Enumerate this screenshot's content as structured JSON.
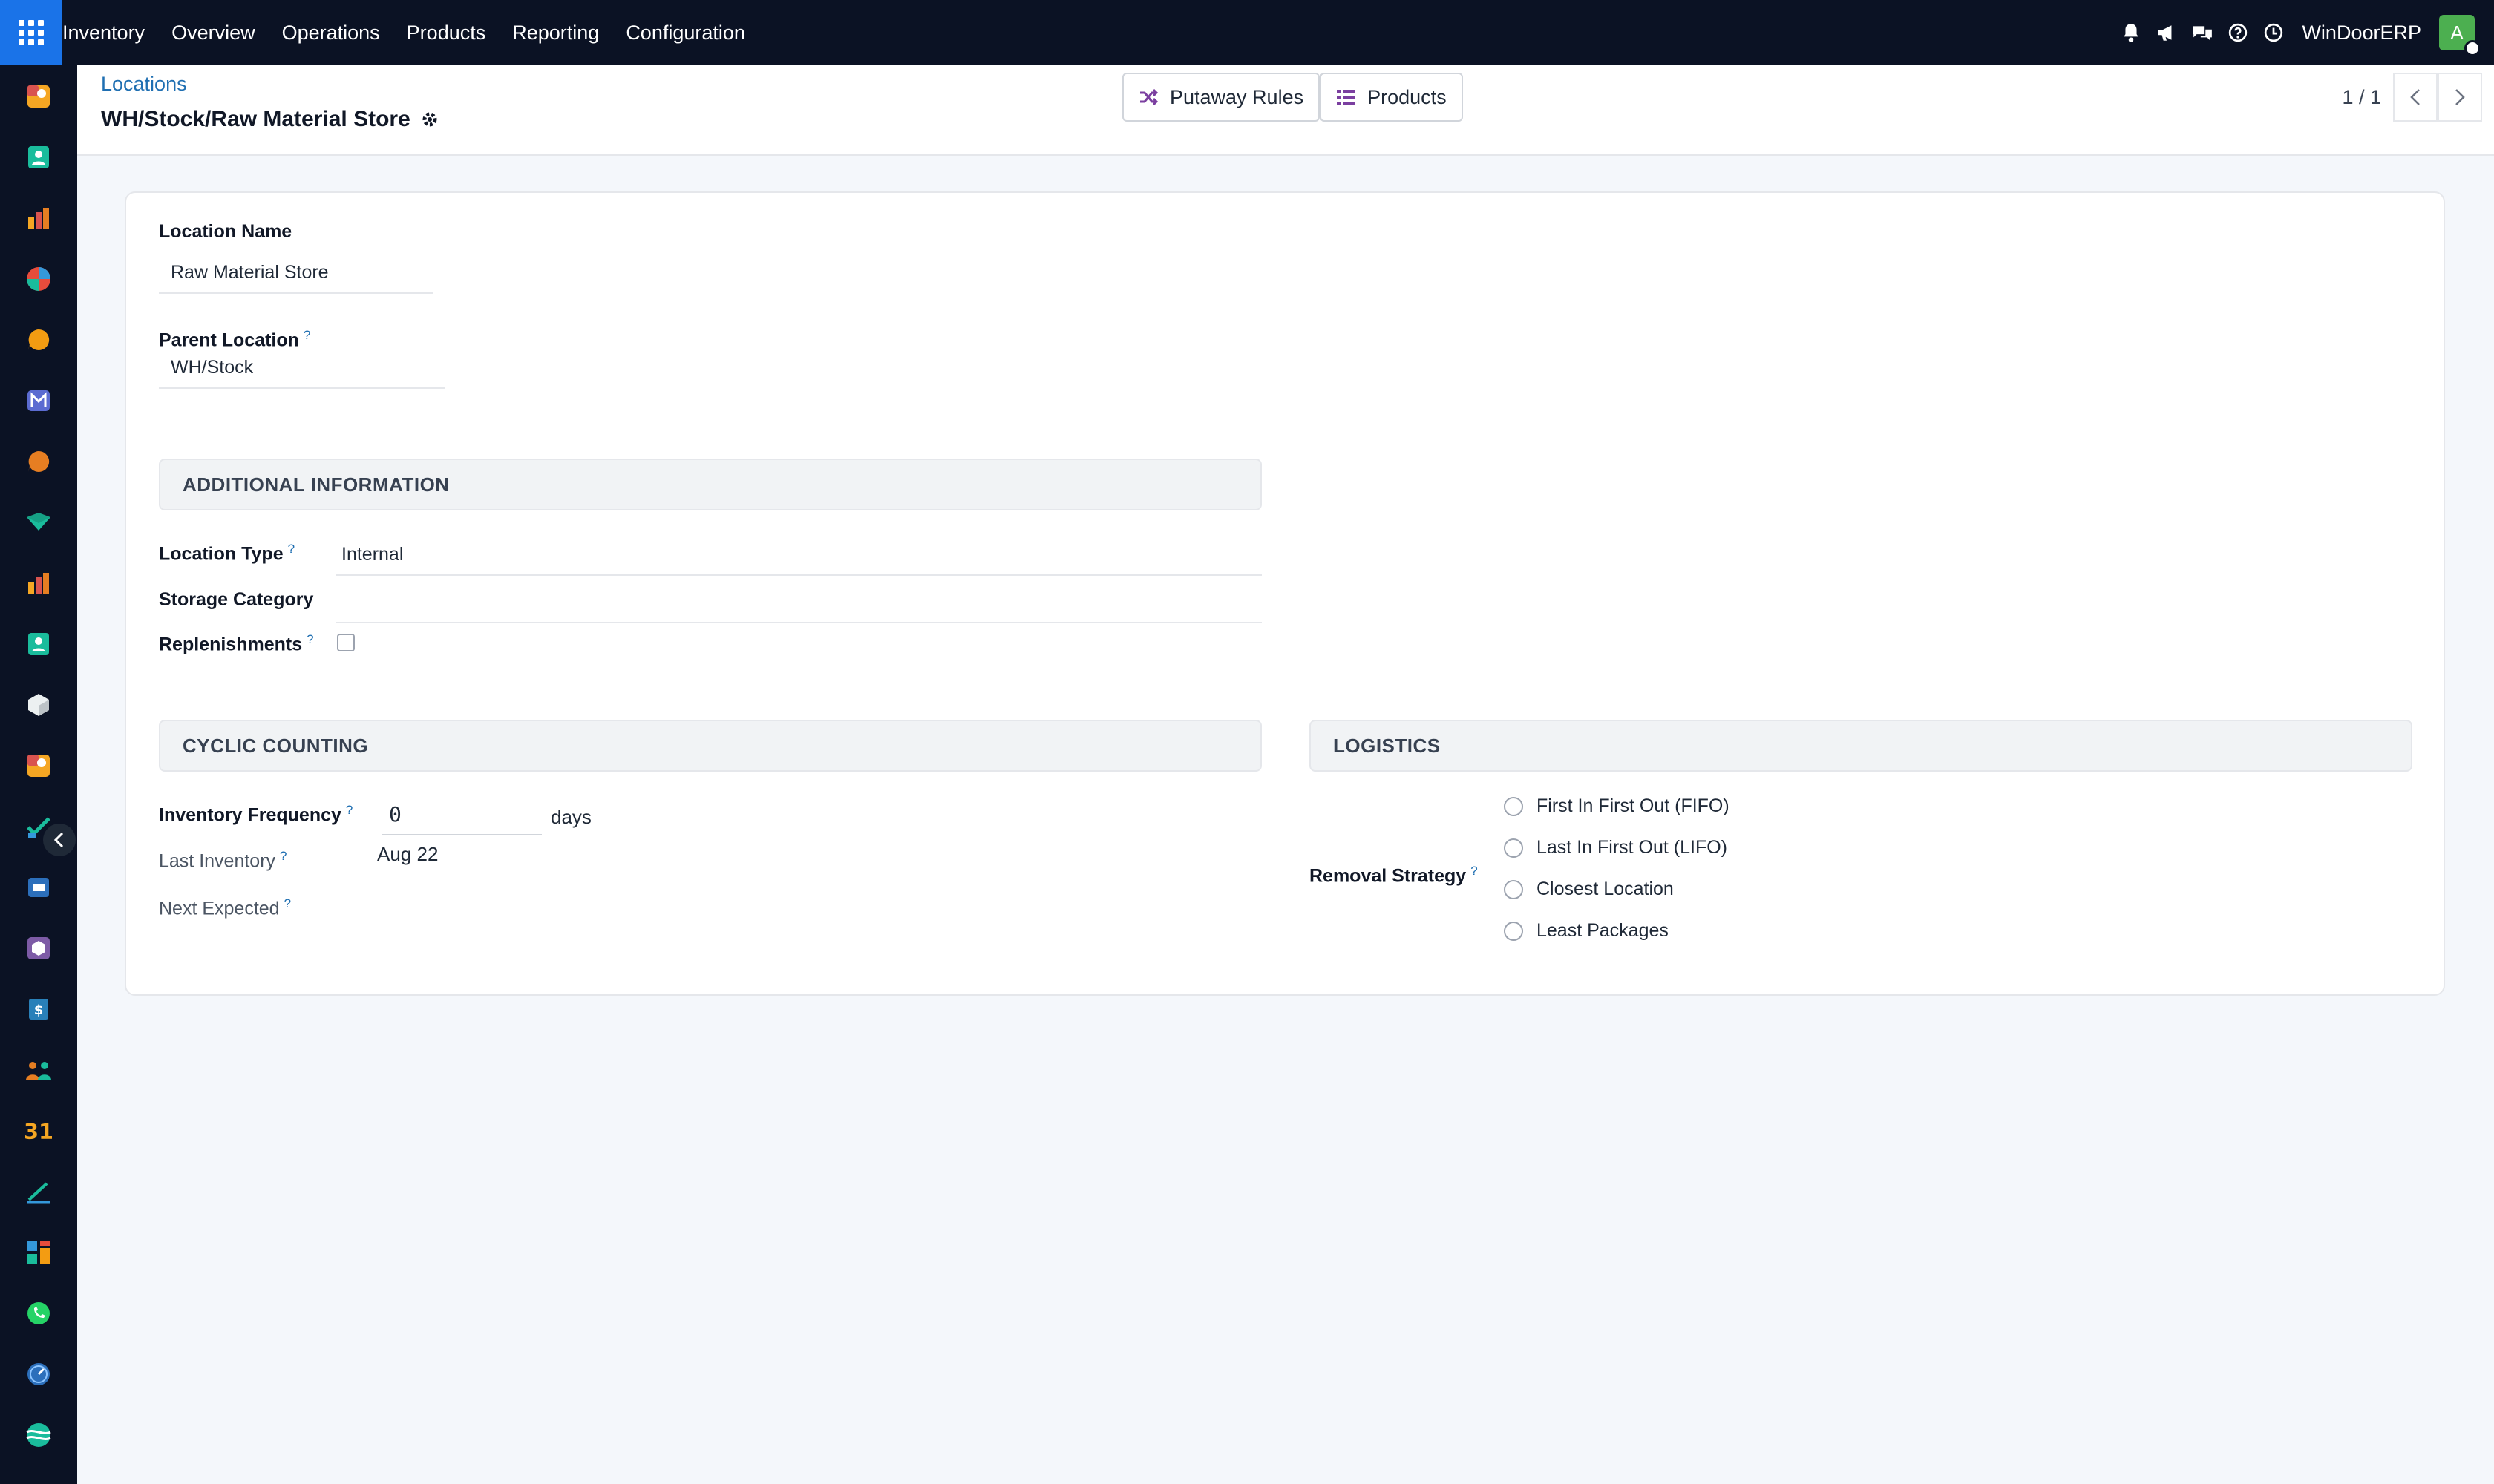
{
  "topbar": {
    "menu": [
      "Inventory",
      "Overview",
      "Operations",
      "Products",
      "Reporting",
      "Configuration"
    ],
    "company": "WinDoorERP",
    "avatar_initial": "A"
  },
  "sidebar": {
    "apps": [
      "studio",
      "contacts",
      "dashboards",
      "discuss",
      "live-chat",
      "mail",
      "helpdesk",
      "marketing",
      "reporting",
      "employees",
      "inventory",
      "studio-2",
      "project",
      "knowledge",
      "products",
      "invoicing",
      "team",
      "calendar",
      "sign",
      "apps",
      "whatsapp",
      "timer",
      "website"
    ]
  },
  "control": {
    "breadcrumb": "Locations",
    "title": "WH/Stock/Raw Material Store",
    "smart_buttons": {
      "putaway": "Putaway Rules",
      "products": "Products"
    },
    "pager": "1 / 1"
  },
  "form": {
    "location_name_label": "Location Name",
    "location_name_value": "Raw Material Store",
    "parent_location_label": "Parent Location",
    "parent_location_value": "WH/Stock",
    "help_mark": "?",
    "additional_info_title": "ADDITIONAL INFORMATION",
    "location_type_label": "Location Type",
    "location_type_value": "Internal",
    "storage_category_label": "Storage Category",
    "storage_category_value": "",
    "replenishments_label": "Replenishments",
    "cyclic_counting_title": "CYCLIC COUNTING",
    "inventory_frequency_label": "Inventory Frequency",
    "inventory_frequency_value": "0",
    "days_unit": "days",
    "last_inventory_label": "Last Inventory",
    "last_inventory_value": "Aug 22",
    "next_expected_label": "Next Expected",
    "logistics_title": "LOGISTICS",
    "removal_strategy_label": "Removal Strategy",
    "removal_options": [
      "First In First Out (FIFO)",
      "Last In First Out (LIFO)",
      "Closest Location",
      "Least Packages"
    ]
  },
  "colors": {
    "navbar": "#0b1224",
    "accent": "#1a73e8",
    "link": "#1f6fb2",
    "avatar": "#4caf50",
    "smart_icon": "#7b3fa0"
  }
}
